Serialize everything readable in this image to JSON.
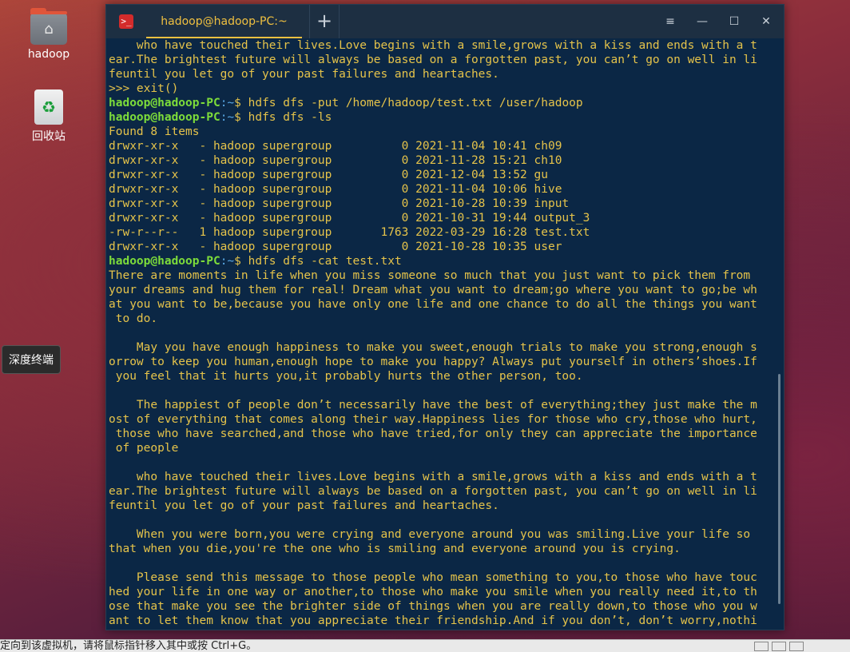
{
  "desktop": {
    "icons": [
      {
        "label": "hadoop",
        "icon": "home-folder-icon"
      },
      {
        "label": "回收站",
        "icon": "trash-icon"
      }
    ],
    "tooltip": "深度终端"
  },
  "terminal": {
    "tab_title": "hadoop@hadoop-PC:~",
    "add_tab": "+",
    "window_buttons": {
      "menu": "≡",
      "minimize": "—",
      "maximize": "☐",
      "close": "✕"
    },
    "prompt_user": "hadoop@hadoop-PC",
    "prompt_path": ":~",
    "lines": [
      {
        "type": "out",
        "text": "    who have touched their lives.Love begins with a smile,grows with a kiss and ends with a t"
      },
      {
        "type": "out",
        "text": "ear.The brightest future will always be based on a forgotten past, you can’t go on well in li"
      },
      {
        "type": "out",
        "text": "feuntil you let go of your past failures and heartaches."
      },
      {
        "type": "out",
        "text": ">>> exit()"
      },
      {
        "type": "cmd",
        "text": "$ hdfs dfs -put /home/hadoop/test.txt /user/hadoop"
      },
      {
        "type": "cmd",
        "text": "$ hdfs dfs -ls"
      },
      {
        "type": "out",
        "text": "Found 8 items"
      },
      {
        "type": "out",
        "text": "drwxr-xr-x   - hadoop supergroup          0 2021-11-04 10:41 ch09"
      },
      {
        "type": "out",
        "text": "drwxr-xr-x   - hadoop supergroup          0 2021-11-28 15:21 ch10"
      },
      {
        "type": "out",
        "text": "drwxr-xr-x   - hadoop supergroup          0 2021-12-04 13:52 gu"
      },
      {
        "type": "out",
        "text": "drwxr-xr-x   - hadoop supergroup          0 2021-11-04 10:06 hive"
      },
      {
        "type": "out",
        "text": "drwxr-xr-x   - hadoop supergroup          0 2021-10-28 10:39 input"
      },
      {
        "type": "out",
        "text": "drwxr-xr-x   - hadoop supergroup          0 2021-10-31 19:44 output_3"
      },
      {
        "type": "out",
        "text": "-rw-r--r--   1 hadoop supergroup       1763 2022-03-29 16:28 test.txt"
      },
      {
        "type": "out",
        "text": "drwxr-xr-x   - hadoop supergroup          0 2021-10-28 10:35 user"
      },
      {
        "type": "cmd",
        "text": "$ hdfs dfs -cat test.txt"
      },
      {
        "type": "out",
        "text": "There are moments in life when you miss someone so much that you just want to pick them from"
      },
      {
        "type": "out",
        "text": "your dreams and hug them for real! Dream what you want to dream;go where you want to go;be wh"
      },
      {
        "type": "out",
        "text": "at you want to be,because you have only one life and one chance to do all the things you want"
      },
      {
        "type": "out",
        "text": " to do."
      },
      {
        "type": "out",
        "text": ""
      },
      {
        "type": "out",
        "text": "    May you have enough happiness to make you sweet,enough trials to make you strong,enough s"
      },
      {
        "type": "out",
        "text": "orrow to keep you human,enough hope to make you happy? Always put yourself in others’shoes.If"
      },
      {
        "type": "out",
        "text": " you feel that it hurts you,it probably hurts the other person, too."
      },
      {
        "type": "out",
        "text": ""
      },
      {
        "type": "out",
        "text": "    The happiest of people don’t necessarily have the best of everything;they just make the m"
      },
      {
        "type": "out",
        "text": "ost of everything that comes along their way.Happiness lies for those who cry,those who hurt,"
      },
      {
        "type": "out",
        "text": " those who have searched,and those who have tried,for only they can appreciate the importance"
      },
      {
        "type": "out",
        "text": " of people"
      },
      {
        "type": "out",
        "text": ""
      },
      {
        "type": "out",
        "text": "    who have touched their lives.Love begins with a smile,grows with a kiss and ends with a t"
      },
      {
        "type": "out",
        "text": "ear.The brightest future will always be based on a forgotten past, you can’t go on well in li"
      },
      {
        "type": "out",
        "text": "feuntil you let go of your past failures and heartaches."
      },
      {
        "type": "out",
        "text": ""
      },
      {
        "type": "out",
        "text": "    When you were born,you were crying and everyone around you was smiling.Live your life so"
      },
      {
        "type": "out",
        "text": "that when you die,you're the one who is smiling and everyone around you is crying."
      },
      {
        "type": "out",
        "text": ""
      },
      {
        "type": "out",
        "text": "    Please send this message to those people who mean something to you,to those who have touc"
      },
      {
        "type": "out",
        "text": "hed your life in one way or another,to those who make you smile when you really need it,to th"
      },
      {
        "type": "out",
        "text": "ose that make you see the brighter side of things when you are really down,to those who you w"
      },
      {
        "type": "out",
        "text": "ant to let them know that you appreciate their friendship.And if you don’t, don’t worry,nothi"
      }
    ]
  },
  "statusbar": {
    "text": "定向到该虚拟机，请将鼠标指针移入其中或按 Ctrl+G。"
  },
  "colors": {
    "terminal_bg": "#0b2745",
    "output_text": "#e5c34a",
    "prompt_user": "#7ddc3a",
    "prompt_path": "#5aa9e6",
    "tab_accent": "#f0c040"
  }
}
